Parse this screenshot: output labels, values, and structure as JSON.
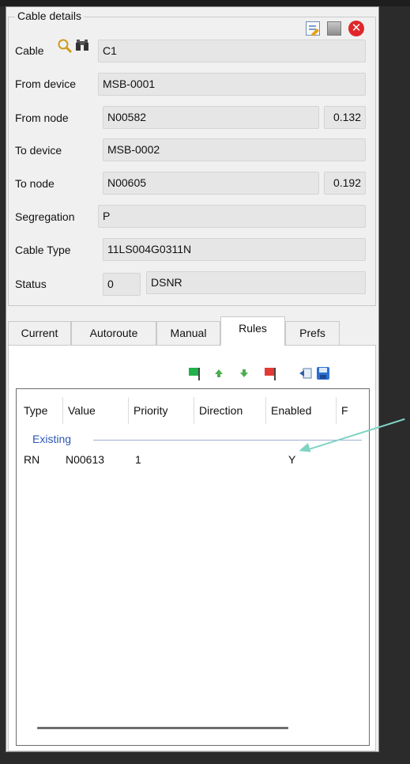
{
  "group_title": "Cable details",
  "fields": {
    "cable": {
      "label": "Cable",
      "value": "C1"
    },
    "from_device": {
      "label": "From device",
      "value": "MSB-0001"
    },
    "from_node": {
      "label": "From node",
      "value": "N00582",
      "extra": "0.132"
    },
    "to_device": {
      "label": "To device",
      "value": "MSB-0002"
    },
    "to_node": {
      "label": "To node",
      "value": "N00605",
      "extra": "0.192"
    },
    "segregation": {
      "label": "Segregation",
      "value": "P"
    },
    "cable_type": {
      "label": "Cable Type",
      "value": "11LS004G0311N"
    },
    "status": {
      "label": "Status",
      "code": "0",
      "value": "DSNR"
    }
  },
  "tabs": [
    "Current",
    "Autoroute",
    "Manual",
    "Rules",
    "Prefs"
  ],
  "active_tab": "Rules",
  "table": {
    "columns": [
      "Type",
      "Value",
      "Priority",
      "Direction",
      "Enabled",
      "F"
    ],
    "group_label": "Existing",
    "rows": [
      {
        "type": "RN",
        "value": "N00613",
        "priority": "1",
        "direction": "",
        "enabled": "Y"
      }
    ]
  },
  "colors": {
    "accent_group": "#2b57b5",
    "annotation_arrow": "#7fd3c3"
  },
  "icons": [
    "edit-icon",
    "stop-icon",
    "close-icon",
    "search-icon",
    "binoculars-icon",
    "add-flag-icon",
    "move-up-icon",
    "move-down-icon",
    "delete-flag-icon",
    "import-icon",
    "save-icon"
  ]
}
